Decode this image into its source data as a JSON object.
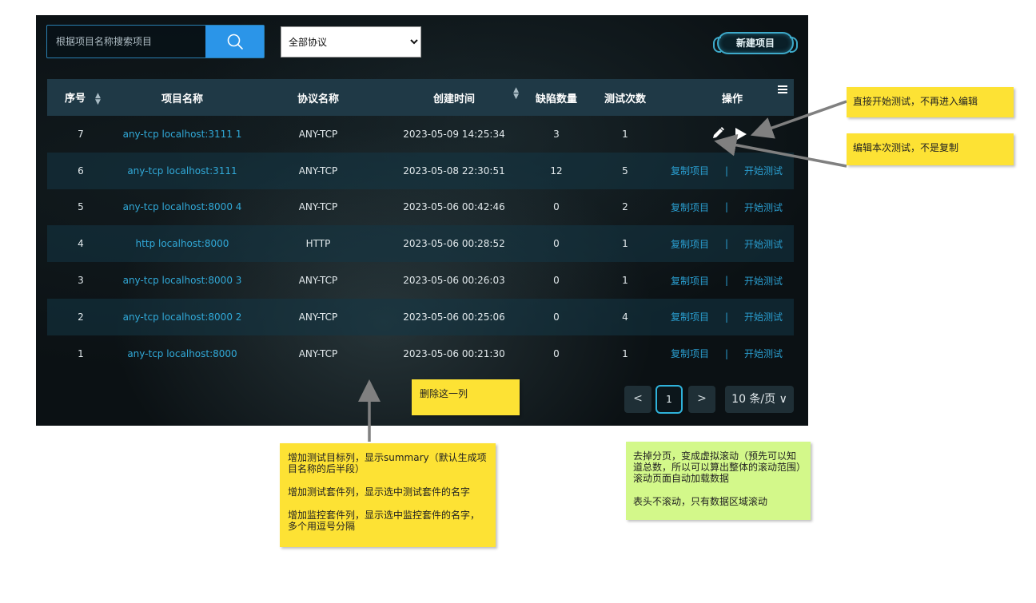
{
  "search": {
    "placeholder": "根据项目名称搜索项目"
  },
  "filter": {
    "selected": "全部协议"
  },
  "toolbar": {
    "new_project_label": "新建项目"
  },
  "table": {
    "headers": {
      "seq": "序号",
      "name": "项目名称",
      "protocol": "协议名称",
      "created": "创建时间",
      "defects": "缺陷数量",
      "tests": "测试次数",
      "ops": "操作"
    },
    "rows": [
      {
        "seq": "7",
        "name": "any-tcp localhost:3111 1",
        "protocol": "ANY-TCP",
        "created": "2023-05-09 14:25:34",
        "defects": "3",
        "tests": "1",
        "ops": "icons"
      },
      {
        "seq": "6",
        "name": "any-tcp localhost:3111",
        "protocol": "ANY-TCP",
        "created": "2023-05-08 22:30:51",
        "defects": "12",
        "tests": "5",
        "ops": "links"
      },
      {
        "seq": "5",
        "name": "any-tcp localhost:8000 4",
        "protocol": "ANY-TCP",
        "created": "2023-05-06 00:42:46",
        "defects": "0",
        "tests": "2",
        "ops": "links"
      },
      {
        "seq": "4",
        "name": "http localhost:8000",
        "protocol": "HTTP",
        "created": "2023-05-06 00:28:52",
        "defects": "0",
        "tests": "1",
        "ops": "links"
      },
      {
        "seq": "3",
        "name": "any-tcp localhost:8000 3",
        "protocol": "ANY-TCP",
        "created": "2023-05-06 00:26:03",
        "defects": "0",
        "tests": "1",
        "ops": "links"
      },
      {
        "seq": "2",
        "name": "any-tcp localhost:8000 2",
        "protocol": "ANY-TCP",
        "created": "2023-05-06 00:25:06",
        "defects": "0",
        "tests": "4",
        "ops": "links"
      },
      {
        "seq": "1",
        "name": "any-tcp localhost:8000",
        "protocol": "ANY-TCP",
        "created": "2023-05-06 00:21:30",
        "defects": "0",
        "tests": "1",
        "ops": "links"
      }
    ],
    "ops_labels": {
      "copy": "复制项目",
      "separator": "|",
      "start": "开始测试"
    }
  },
  "pagination": {
    "prev": "<",
    "current": "1",
    "next": ">",
    "page_size": "10 条/页 ∨"
  },
  "notes": {
    "start_test": "直接开始测试，不再进入编辑",
    "edit_test": "编辑本次测试，不是复制",
    "delete_column": "删除这一列",
    "add_columns": [
      "增加测试目标列，显示summary（默认生成项目名称的后半段）",
      "增加测试套件列，显示选中测试套件的名字",
      "增加监控套件列，显示选中监控套件的名字，多个用逗号分隔"
    ],
    "virtual_scroll": [
      "去掉分页，变成虚拟滚动（预先可以知道总数，所以可以算出整体的滚动范围）滚动页面自动加载数据",
      "表头不滚动，只有数据区域滚动"
    ]
  },
  "colors": {
    "accent": "#2b95e8",
    "link": "#31a9d8",
    "header_bg": "#1f3946",
    "note_yellow": "#fde234",
    "note_green": "#d3f88a"
  }
}
